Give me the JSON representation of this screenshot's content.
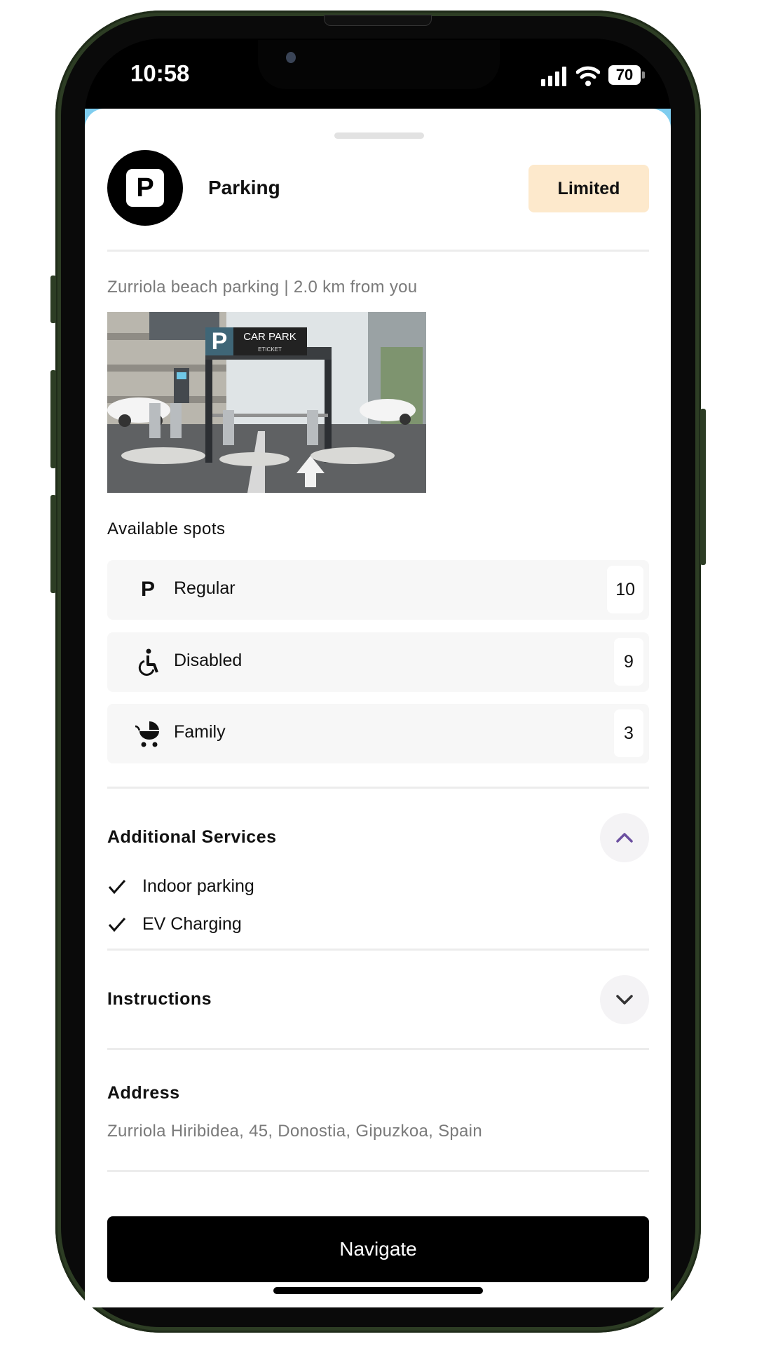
{
  "status_bar": {
    "time": "10:58",
    "battery": "70",
    "icons": [
      "signal-icon",
      "wifi-icon",
      "battery-icon"
    ]
  },
  "header": {
    "icon": "parking-icon",
    "title": "Parking",
    "badge": "Limited",
    "badge_color": "#fde9cc"
  },
  "subtitle": "Zurriola beach parking | 2.0 km from you",
  "image": {
    "sign_letter": "P",
    "sign_text": "CAR PARK",
    "sign_subtext": "ETICKET"
  },
  "spots": {
    "title": "Available spots",
    "items": [
      {
        "icon": "parking-p-icon",
        "label": "Regular",
        "count": "10"
      },
      {
        "icon": "wheelchair-icon",
        "label": "Disabled",
        "count": "9"
      },
      {
        "icon": "stroller-icon",
        "label": "Family",
        "count": "3"
      }
    ]
  },
  "additional_services": {
    "title": "Additional Services",
    "expanded": true,
    "chevron_color": "#6b4fa0",
    "items": [
      "Indoor parking",
      "EV Charging"
    ]
  },
  "instructions": {
    "title": "Instructions",
    "expanded": false
  },
  "address": {
    "title": "Address",
    "value": "Zurriola Hiribidea, 45, Donostia, Gipuzkoa, Spain"
  },
  "navigate_button": "Navigate"
}
